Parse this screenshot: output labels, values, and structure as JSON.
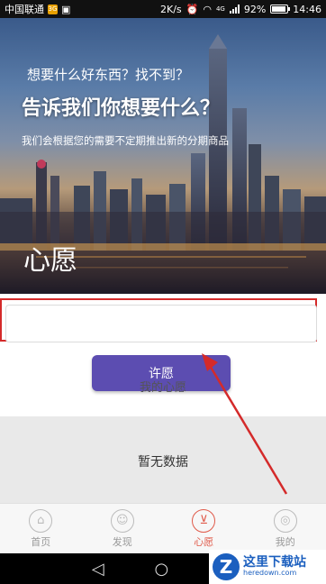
{
  "status_bar": {
    "carrier": "中国联通",
    "sim_badge": "3G",
    "speed": "2K/s",
    "network": "4G",
    "battery": "92%",
    "battery_level": 0.92,
    "time": "14:46"
  },
  "banner": {
    "subtitle": "想要什么好东西？找不到？",
    "headline": "告诉我们你想要什么？",
    "description": "我们会根据您的需要不定期推出新的分期商品",
    "page_title": "心愿"
  },
  "wish_form": {
    "input_value": "",
    "button_label": "许愿"
  },
  "my_wishes": {
    "title": "我的心愿",
    "empty_text": "暂无数据"
  },
  "bottom_nav": {
    "items": [
      {
        "label": "首页",
        "icon": "home-icon",
        "glyph": "⌂",
        "active": false
      },
      {
        "label": "发现",
        "icon": "discover-icon",
        "glyph": "☺",
        "active": false
      },
      {
        "label": "心愿",
        "icon": "cart-icon",
        "glyph": "🛒",
        "active": true
      },
      {
        "label": "我的",
        "icon": "profile-icon",
        "glyph": "◎",
        "active": false
      }
    ]
  },
  "watermark": {
    "logo_letter": "Z",
    "name": "这里下载站",
    "domain": "heredown.com"
  },
  "colors": {
    "accent": "#5c4db1",
    "active_tab": "#e05a4a",
    "highlight_box": "#d42a2a"
  }
}
